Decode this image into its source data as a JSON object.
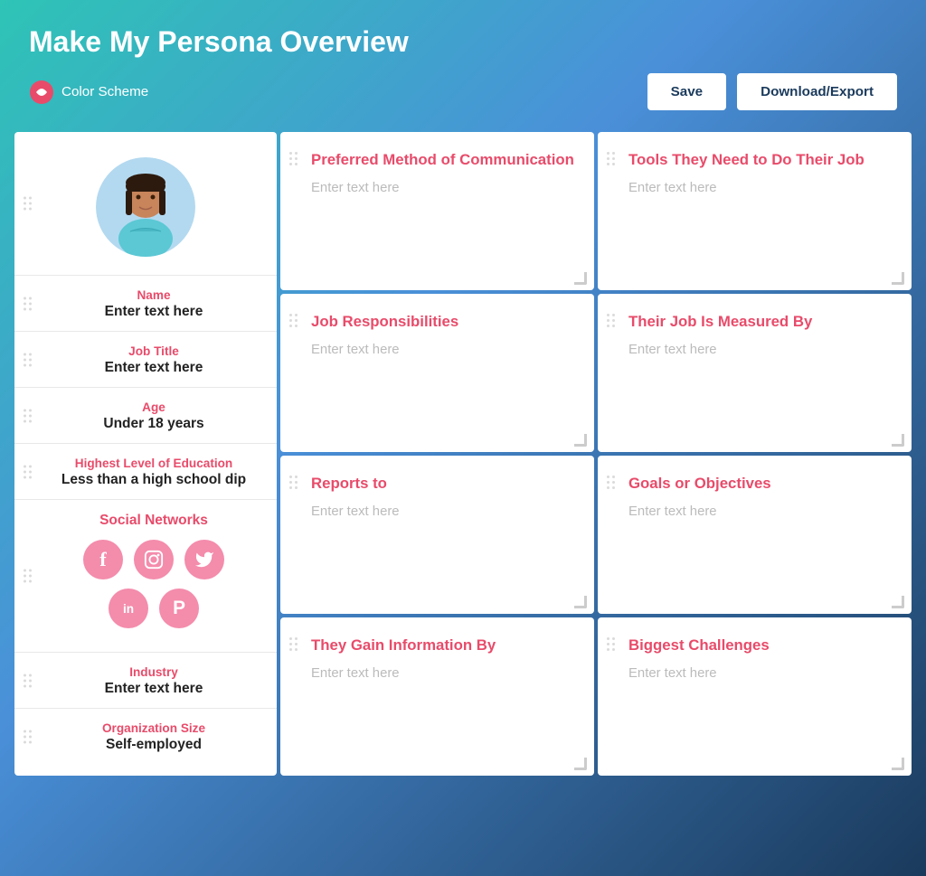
{
  "header": {
    "title": "Make My Persona Overview",
    "color_scheme_label": "Color Scheme",
    "save_label": "Save",
    "download_label": "Download/Export"
  },
  "left_panel": {
    "name_label": "Name",
    "name_value": "Enter text here",
    "job_title_label": "Job Title",
    "job_title_value": "Enter text here",
    "age_label": "Age",
    "age_value": "Under 18 years",
    "education_label": "Highest Level of Education",
    "education_value": "Less than a high school dip",
    "social_label": "Social Networks",
    "industry_label": "Industry",
    "industry_value": "Enter text here",
    "org_size_label": "Organization Size",
    "org_size_value": "Self-employed"
  },
  "cards": [
    {
      "title": "Preferred Method of Communication",
      "placeholder": "Enter text here"
    },
    {
      "title": "Tools They Need to Do Their Job",
      "placeholder": "Enter text here"
    },
    {
      "title": "Job Responsibilities",
      "placeholder": "Enter text here"
    },
    {
      "title": "Their Job Is Measured By",
      "placeholder": "Enter text here"
    },
    {
      "title": "Reports to",
      "placeholder": "Enter text here"
    },
    {
      "title": "Goals or Objectives",
      "placeholder": "Enter text here"
    },
    {
      "title": "They Gain Information By",
      "placeholder": "Enter text here"
    },
    {
      "title": "Biggest Challenges",
      "placeholder": "Enter text here"
    }
  ],
  "social_icons": [
    {
      "name": "facebook",
      "symbol": "f"
    },
    {
      "name": "instagram",
      "symbol": "📷"
    },
    {
      "name": "twitter",
      "symbol": "🐦"
    },
    {
      "name": "linkedin",
      "symbol": "in"
    },
    {
      "name": "pinterest",
      "symbol": "P"
    }
  ]
}
